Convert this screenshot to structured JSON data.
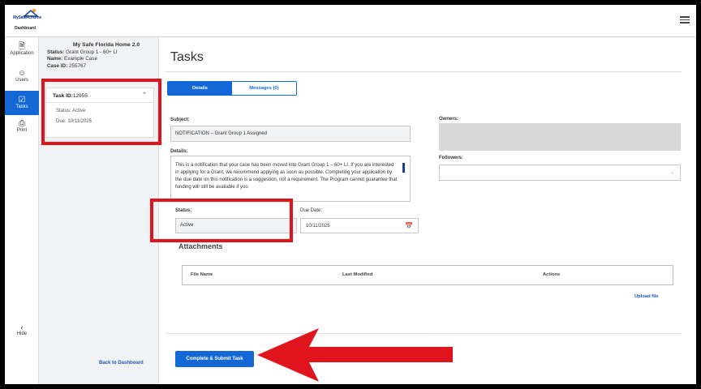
{
  "header": {
    "logo_text": "MySafeFLHome",
    "logo_subtitle": "Dashboard"
  },
  "rail": {
    "items": [
      {
        "label": "Application",
        "icon": "document-icon"
      },
      {
        "label": "Users",
        "icon": "users-icon"
      },
      {
        "label": "Tasks",
        "icon": "tasks-icon",
        "active": true
      },
      {
        "label": "Print",
        "icon": "print-icon"
      }
    ],
    "hide_label": "Hide"
  },
  "case": {
    "title": "My Safe Florida Home 2.0",
    "status_label": "Status:",
    "status_value": "Grant Group 1 - 60+ LI",
    "name_label": "Name:",
    "name_value": "Example Case",
    "case_id_label": "Case ID:",
    "case_id_value": "255767"
  },
  "task_card": {
    "task_id_label": "Task ID:",
    "task_id_value": "12955",
    "status_text": "Status: Active",
    "due_text": "Due: 10/11/2025"
  },
  "back_link": "Back to Dashboard",
  "main": {
    "title": "Tasks",
    "tabs": [
      {
        "label": "Details",
        "active": true
      },
      {
        "label": "Messages (0)",
        "active": false
      }
    ],
    "subject_label": "Subject:",
    "subject_value": "NOTIFICATION – Grant Group 1 Assigned",
    "details_label": "Details:",
    "details_text": "This is a notification that your case has been moved into Grant Group 1 – 60+ LI. If you are interested in applying for a Grant, we recommend applying as soon as possible. Completing your application by the due date on this notification is a suggestion, not a requirement. The Program cannot guarantee that funding will still be available if you",
    "owners_label": "Owners:",
    "followers_label": "Followers:",
    "status_label": "Status:",
    "status_value": "Active",
    "due_label": "Due Date:",
    "due_value": "10/11/2025",
    "attachments_title": "Attachments",
    "table_headers": [
      "File Name",
      "Last Modified",
      "Actions"
    ],
    "upload_label": "Upload file",
    "submit_label": "Complete & Submit Task"
  },
  "colors": {
    "accent": "#1468d6",
    "annotation": "#e0141c",
    "link": "#1a58b8"
  }
}
